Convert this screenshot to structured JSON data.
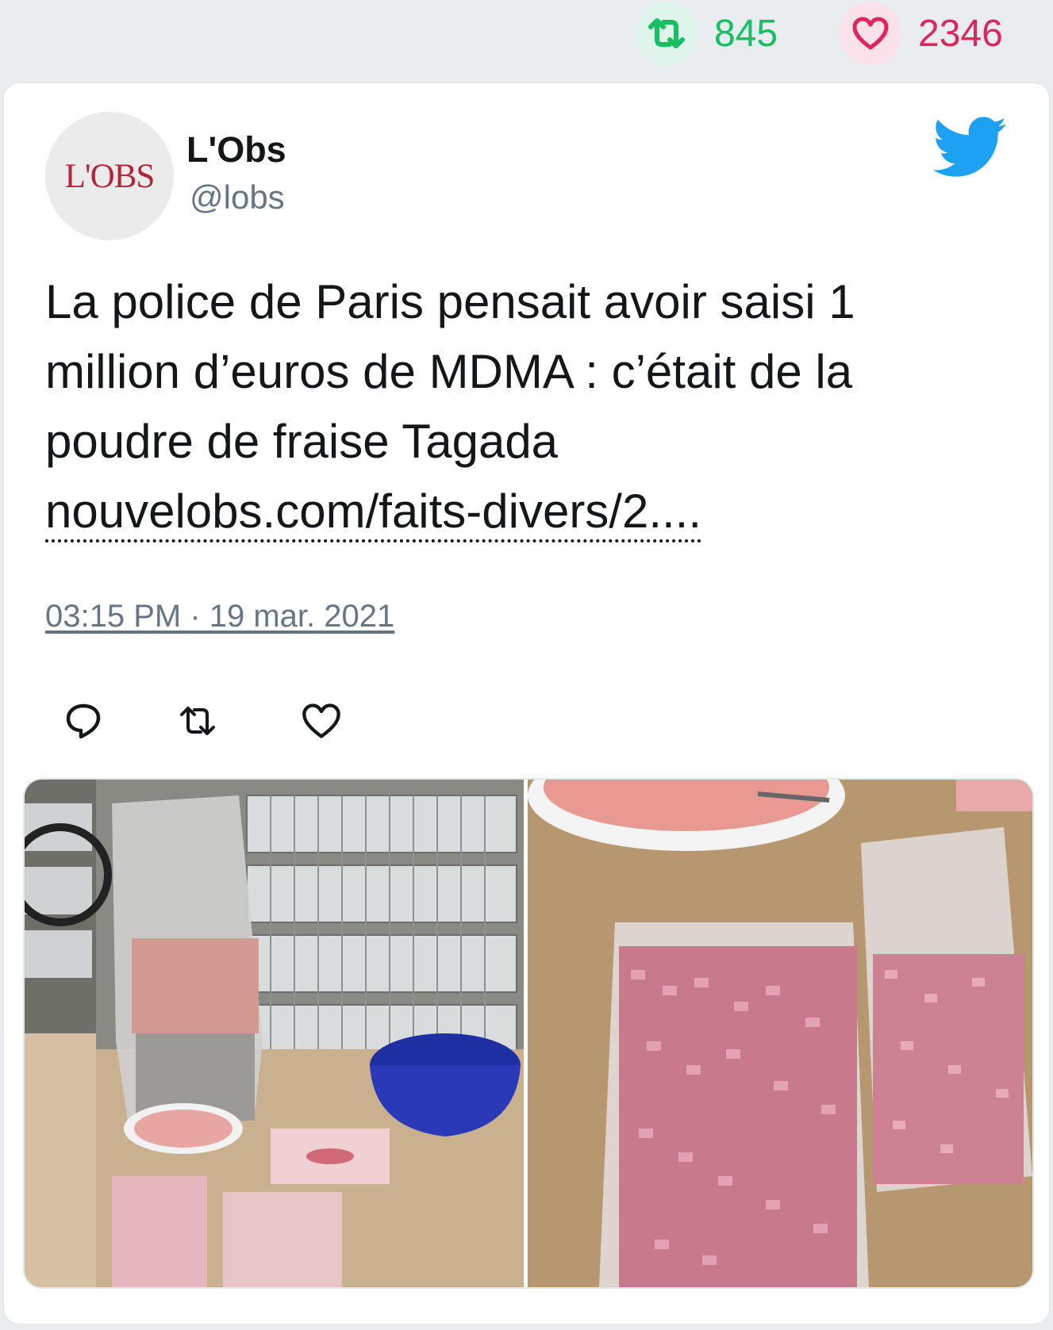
{
  "stats": {
    "retweets": "845",
    "likes": "2346",
    "retweet_color": "#17bf63",
    "like_color": "#e0245e"
  },
  "tweet": {
    "avatar_logo": "L'OBS",
    "display_name": "L'Obs",
    "handle": "@lobs",
    "text_lines": [
      "La police de Paris pensait avoir saisi 1",
      "million d’euros de MDMA : c’était de la",
      "poudre de fraise Tagada"
    ],
    "link": "nouvelobs.com/faits-divers/2....",
    "timestamp": "03:15 PM · 19 mar. 2021",
    "icons": {
      "brand": "twitter-bird-icon",
      "reply": "reply-icon",
      "retweet": "retweet-icon",
      "like": "heart-icon"
    }
  },
  "colors": {
    "twitter_blue": "#1da1f2",
    "text": "#14171a",
    "muted": "#657786"
  }
}
